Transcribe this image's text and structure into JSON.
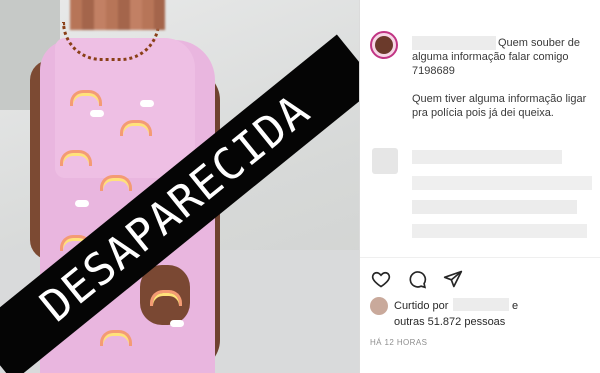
{
  "photo": {
    "banner_text": "DESAPARECIDA"
  },
  "post": {
    "caption_line1": "Quem souber de",
    "caption_line2": "alguma informação falar comigo",
    "caption_line3": "7198689",
    "caption_line4": "Quem tiver alguma informação ligar",
    "caption_line5": "pra polícia pois já dei queixa."
  },
  "actions": {
    "like_icon": "heart-icon",
    "comment_icon": "comment-icon",
    "share_icon": "share-icon"
  },
  "likes": {
    "prefix": "Curtido por",
    "suffix": "e",
    "others": "outras 51.872 pessoas"
  },
  "timestamp": "HÁ 12 HORAS",
  "colors": {
    "banner_bg": "#050505",
    "avatar_ring": "#c13584",
    "text_dark": "#262626",
    "text_muted": "#8e8e8e"
  }
}
